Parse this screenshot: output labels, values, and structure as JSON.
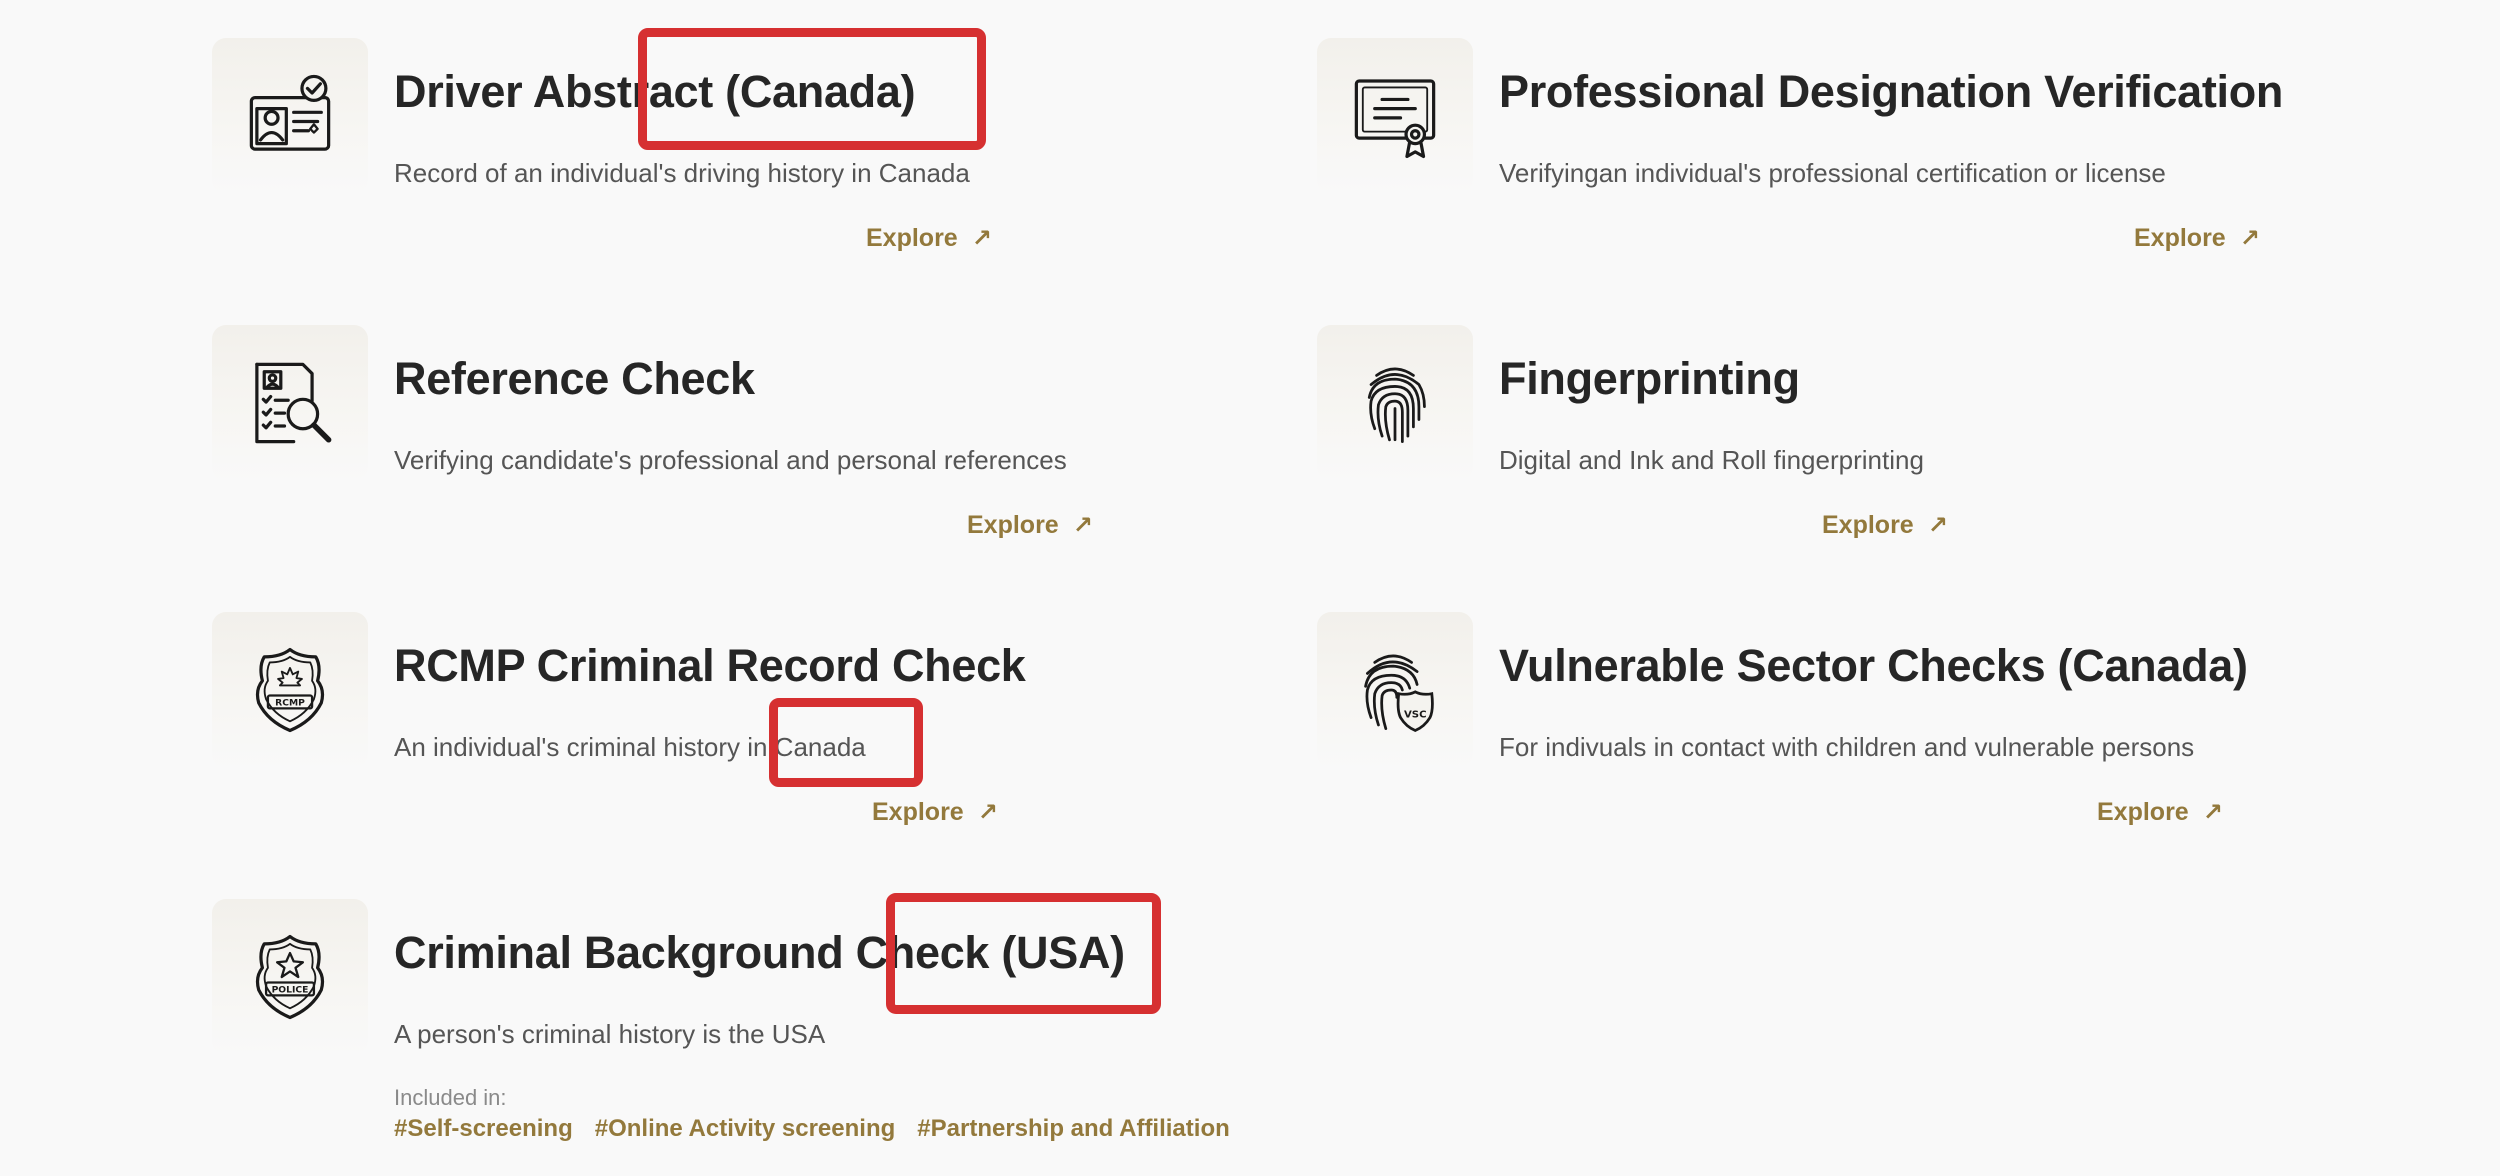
{
  "cards": [
    {
      "title": "Driver Abstract (Canada)",
      "description": "Record of an individual's driving history in Canada",
      "explore_label": "Explore",
      "icon": "driver-license-icon"
    },
    {
      "title": "Professional Designation Verification",
      "description": "Verifyingan individual's professional certification or license",
      "explore_label": "Explore",
      "icon": "certificate-icon"
    },
    {
      "title": "Reference Check",
      "description": "Verifying candidate's professional and personal references",
      "explore_label": "Explore",
      "icon": "document-search-icon"
    },
    {
      "title": "Fingerprinting",
      "description": "Digital and Ink and Roll fingerprinting",
      "explore_label": "Explore",
      "icon": "fingerprint-icon"
    },
    {
      "title": "RCMP Criminal Record Check",
      "description": "An individual's criminal history in Canada",
      "explore_label": "Explore",
      "icon": "rcmp-badge-icon",
      "badge_text": "RCMP"
    },
    {
      "title": "Vulnerable Sector Checks (Canada)",
      "description": "For indivuals in contact with children and vulnerable persons",
      "explore_label": "Explore",
      "icon": "fingerprint-shield-icon",
      "badge_text": "VSC"
    },
    {
      "title": "Criminal Background Check (USA)",
      "description": "A person's criminal history is the USA",
      "icon": "police-badge-icon",
      "badge_text": "POLICE",
      "included_label": "Included in:",
      "tags": [
        "#Self-screening",
        "#Online Activity screening",
        "#Partnership and Affiliation"
      ]
    }
  ],
  "colors": {
    "accent": "#93793c",
    "highlight": "#d63031",
    "background": "#f9f9f9",
    "title": "#262626",
    "description": "#555555"
  }
}
